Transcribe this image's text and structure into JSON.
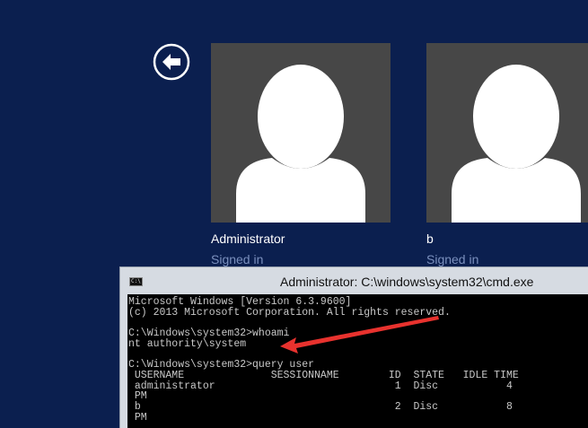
{
  "login": {
    "back_icon": "back-arrow-icon",
    "tiles": [
      {
        "name": "Administrator",
        "status": "Signed in",
        "avatar_icon": "user-silhouette-icon"
      },
      {
        "name": "b",
        "status": "Signed in",
        "avatar_icon": "user-silhouette-icon"
      }
    ]
  },
  "cmd": {
    "title": "Administrator: C:\\windows\\system32\\cmd.exe",
    "icon_label": "C:\\",
    "lines": [
      "Microsoft Windows [Version 6.3.9600]",
      "(c) 2013 Microsoft Corporation. All rights reserved.",
      "",
      "C:\\Windows\\system32>whoami",
      "nt authority\\system",
      "",
      "C:\\Windows\\system32>query user",
      " USERNAME              SESSIONNAME        ID  STATE   IDLE TIME",
      " administrator                             1  Disc           4",
      " PM",
      " b                                         2  Disc           8",
      " PM"
    ]
  },
  "colors": {
    "background": "#0b1f4f",
    "tile": "#474747",
    "status_text": "#7a8fbd",
    "annotation_arrow": "#e8322e"
  }
}
